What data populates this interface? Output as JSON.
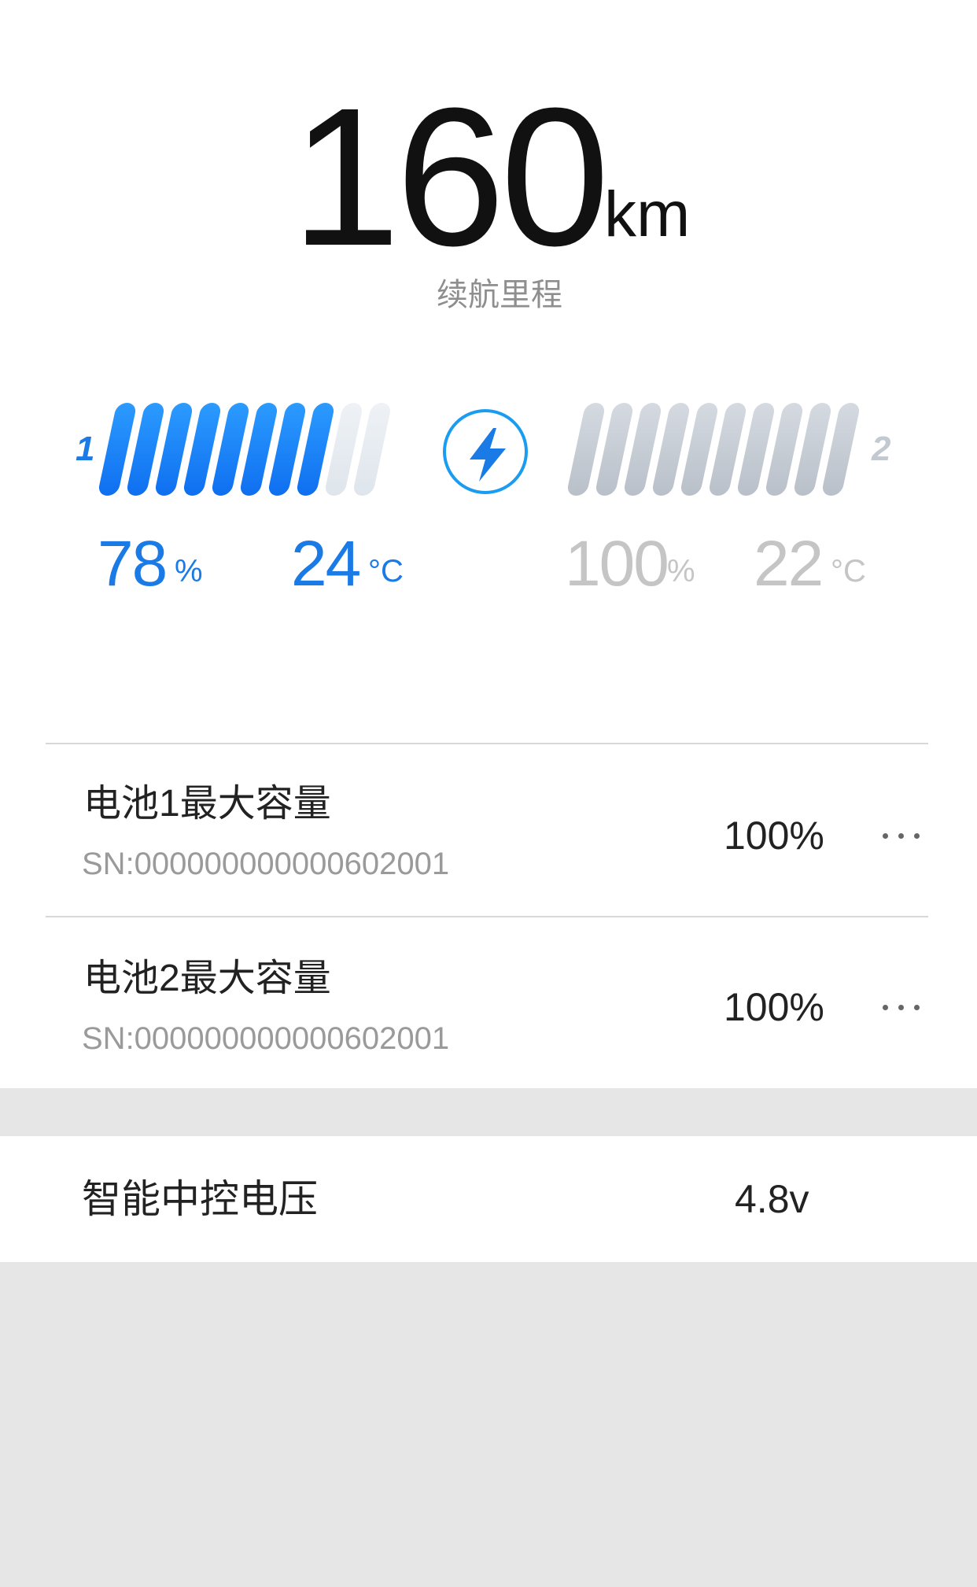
{
  "range": {
    "value": "160",
    "unit": "km",
    "label": "续航里程"
  },
  "charging_icon": "lightning-bolt-icon",
  "colors": {
    "accent_blue": "#1a7ae6",
    "charge_ring": "#1a9cf0",
    "inactive_grey": "#c5c5c5"
  },
  "battery1": {
    "index": "1",
    "level_bars_total": 10,
    "level_bars_filled": 8,
    "percent": "78",
    "percent_unit": "%",
    "temperature": "24",
    "temperature_unit": "°C"
  },
  "battery2": {
    "index": "2",
    "level_bars_total": 10,
    "level_bars_filled": 10,
    "percent": "100",
    "percent_unit": "%",
    "temperature": "22",
    "temperature_unit": "°C"
  },
  "capacity_list": [
    {
      "title": "电池1最大容量",
      "sn": "SN:000000000000602001",
      "value": "100%"
    },
    {
      "title": "电池2最大容量",
      "sn": "SN:000000000000602001",
      "value": "100%"
    }
  ],
  "voltage": {
    "label": "智能中控电压",
    "value": "4.8v"
  }
}
